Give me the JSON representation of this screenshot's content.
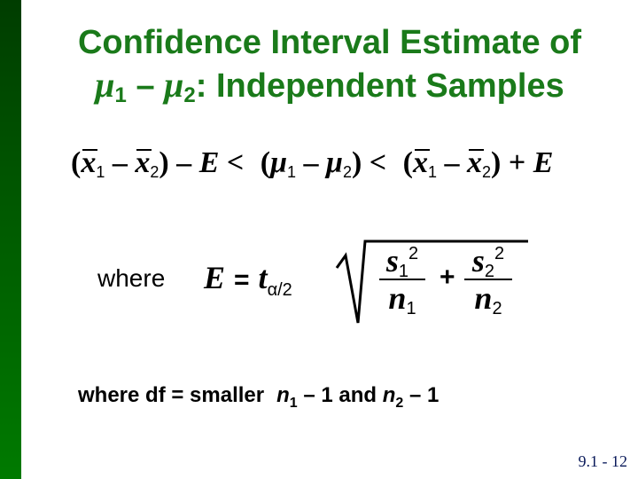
{
  "slide": {
    "title": {
      "line1": "Confidence Interval Estimate of",
      "mu": "μ",
      "sub1": "1",
      "minus": " – ",
      "sub2": "2",
      "line2_rest": ": Independent Samples"
    },
    "ci_formula": {
      "open1": "(",
      "x": "x",
      "sub1": "1",
      "minus": " – ",
      "sub2": "2",
      "close_minus_E": ") – ",
      "E": "E",
      "lt": " < ",
      "mu_open": "(",
      "mu": "μ",
      "mu_close": ")",
      "close_plus_E": ") + "
    },
    "margin_formula": {
      "where": "where",
      "E": "E",
      "equals": "=",
      "t": "t",
      "t_sub": "α/2",
      "s": "s",
      "n": "n",
      "sub1": "1",
      "sub2": "2",
      "squared": "2",
      "plus": "+"
    },
    "df_note": {
      "prefix": "where df = smaller",
      "n": "n",
      "sub1": "1",
      "mid": " – 1 and ",
      "sub2": "2",
      "suffix": " – 1"
    },
    "slide_number": "9.1 - 12"
  },
  "colors": {
    "title": "#1a7a1a",
    "sidebar_top": "#003d00",
    "sidebar_bottom": "#007a00",
    "slide_number": "#0a1a5a"
  }
}
